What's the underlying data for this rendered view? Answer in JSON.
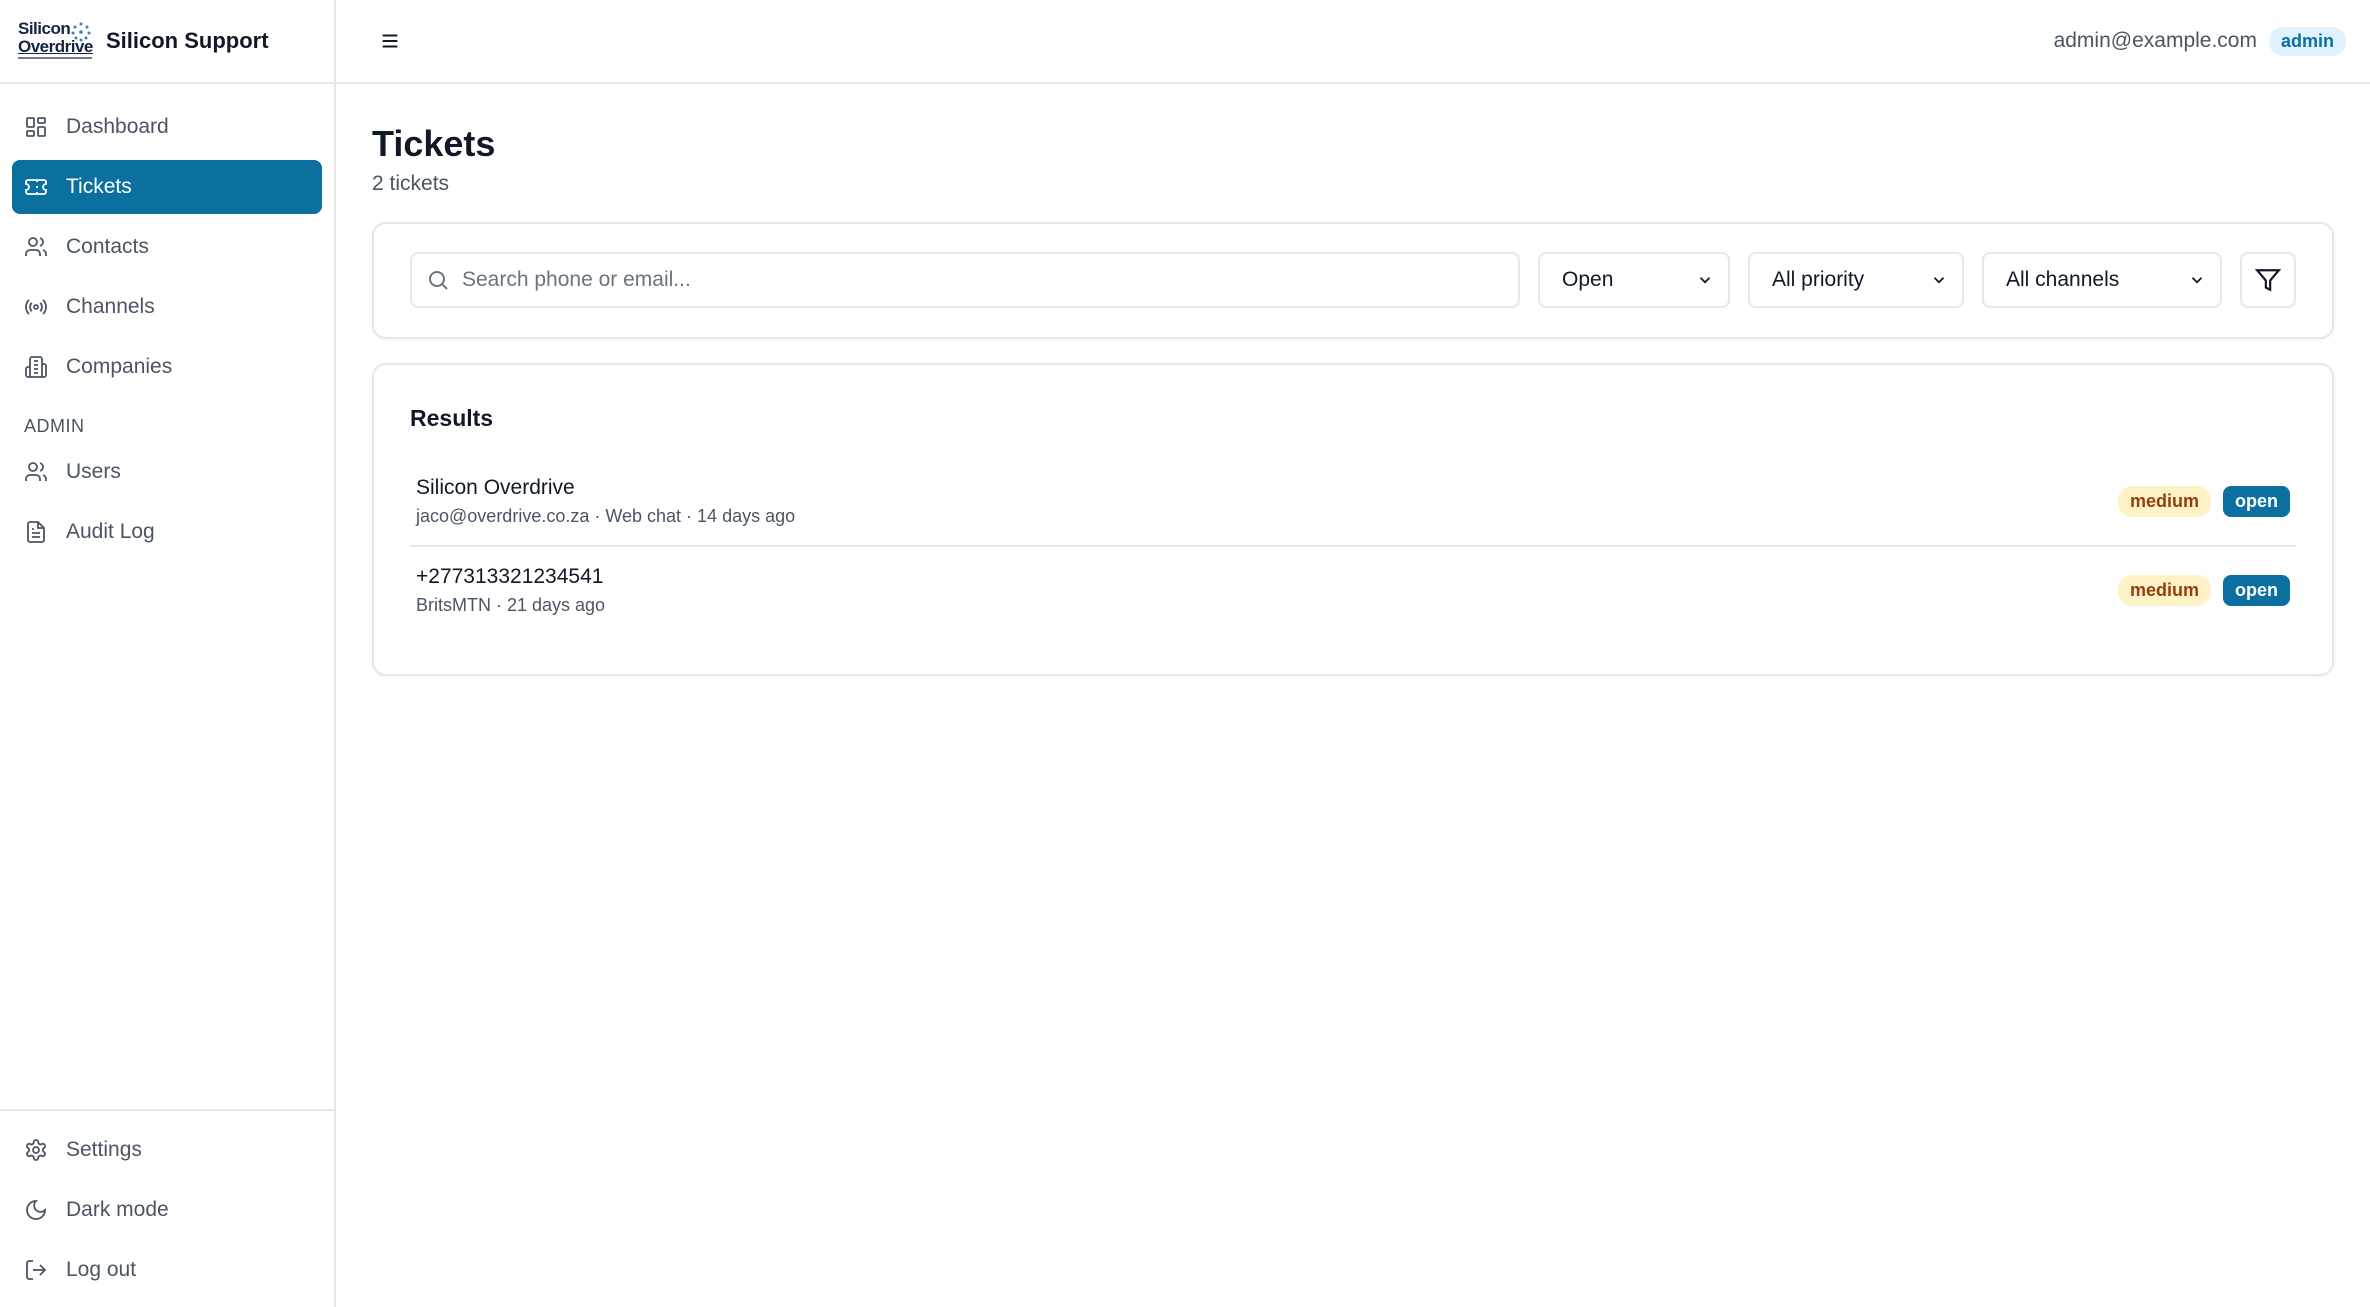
{
  "brand": {
    "logo_line1": "Silicon",
    "logo_line2": "Overdrive",
    "name": "Silicon Support"
  },
  "sidebar": {
    "items": [
      {
        "label": "Dashboard",
        "icon": "dashboard-icon"
      },
      {
        "label": "Tickets",
        "icon": "ticket-icon",
        "active": true
      },
      {
        "label": "Contacts",
        "icon": "users-icon"
      },
      {
        "label": "Channels",
        "icon": "radio-icon"
      },
      {
        "label": "Companies",
        "icon": "building-icon"
      }
    ],
    "admin_label": "ADMIN",
    "admin_items": [
      {
        "label": "Users",
        "icon": "users-icon"
      },
      {
        "label": "Audit Log",
        "icon": "file-icon"
      }
    ],
    "bottom_items": [
      {
        "label": "Settings",
        "icon": "gear-icon"
      },
      {
        "label": "Dark mode",
        "icon": "moon-icon"
      },
      {
        "label": "Log out",
        "icon": "logout-icon"
      }
    ]
  },
  "header": {
    "user_email": "admin@example.com",
    "role": "admin"
  },
  "page": {
    "title": "Tickets",
    "subtitle": "2 tickets"
  },
  "filters": {
    "search_placeholder": "Search phone or email...",
    "status": "Open",
    "priority": "All priority",
    "channels": "All channels"
  },
  "results": {
    "title": "Results",
    "tickets": [
      {
        "title": "Silicon Overdrive",
        "meta": "jaco@overdrive.co.za · Web chat · 14 days ago",
        "priority": "medium",
        "status": "open"
      },
      {
        "title": "+277313321234541",
        "meta": "BritsMTN · 21 days ago",
        "priority": "medium",
        "status": "open"
      }
    ]
  },
  "colors": {
    "accent": "#0b6fa0",
    "priority_bg": "#fef3c7",
    "priority_text": "#92400e",
    "border": "#e5e7eb"
  }
}
